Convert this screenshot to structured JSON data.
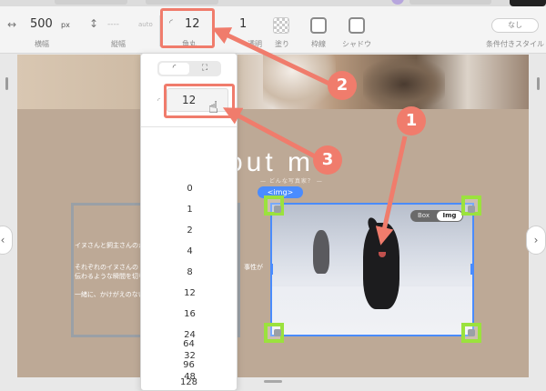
{
  "toolbar": {
    "width": {
      "icon": "horizontal-resize-icon",
      "value": "500",
      "unit": "px",
      "label": "横幅"
    },
    "height": {
      "icon": "vertical-resize-icon",
      "value": "----",
      "auto": "auto",
      "label": "縦幅"
    },
    "radius": {
      "icon": "corner-radius-icon",
      "value": "12",
      "label": "角丸"
    },
    "opacity_value": "1",
    "opacity_label": "透明",
    "fill_label": "塗り",
    "border_label": "枠線",
    "shadow_label": "シャドウ",
    "conditional_style": {
      "value": "なし",
      "label": "条件付きスタイル"
    }
  },
  "dropdown": {
    "modes": [
      "◜",
      "⛶"
    ],
    "input_value": "12",
    "options": [
      "0",
      "1",
      "2",
      "4",
      "8",
      "12",
      "16",
      "24",
      "32",
      "48",
      "64",
      "96",
      "128"
    ]
  },
  "canvas": {
    "title": "out m",
    "subtitle": "— どんな写真家？ —",
    "img_badge": "<img>",
    "toggle": {
      "box": "Box",
      "img": "Img"
    },
    "paragraphs": [
      "イヌさんと飼主さんのか",
      "それぞれのイヌさんの",
      "伝わるような瞬間を切り",
      "一緒に、かけがえのない"
    ],
    "paragraph_tail": "事性が"
  },
  "annotations": {
    "color": "#f07c6c",
    "handle_color": "#9be23d",
    "badges": [
      "1",
      "2",
      "3"
    ]
  },
  "nav": {
    "left": "‹",
    "right": "›"
  }
}
